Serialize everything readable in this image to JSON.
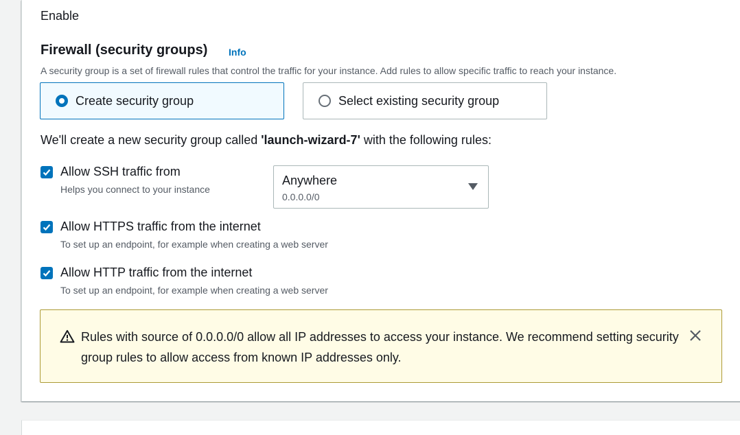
{
  "enable_text": "Enable",
  "firewall": {
    "title": "Firewall (security groups)",
    "info_link": "Info",
    "description": "A security group is a set of firewall rules that control the traffic for your instance. Add rules to allow specific traffic to reach your instance."
  },
  "options": {
    "create": {
      "label": "Create security group",
      "selected": true
    },
    "existing": {
      "label": "Select existing security group",
      "selected": false
    }
  },
  "create_note": {
    "prefix": "We'll create a new security group called ",
    "name": "'launch-wizard-7'",
    "suffix": " with the following rules:"
  },
  "rules": [
    {
      "label": "Allow SSH traffic from",
      "description": "Helps you connect to your instance",
      "checked": true
    },
    {
      "label": "Allow HTTPS traffic from the internet",
      "description": "To set up an endpoint, for example when creating a web server",
      "checked": true
    },
    {
      "label": "Allow HTTP traffic from the internet",
      "description": "To set up an endpoint, for example when creating a web server",
      "checked": true
    }
  ],
  "ssh_source": {
    "value": "Anywhere",
    "sub": "0.0.0.0/0"
  },
  "alert": {
    "text": "Rules with source of 0.0.0.0/0 allow all IP addresses to access your instance. We recommend setting security group rules to allow access from known IP addresses only.",
    "icon": "warning-icon",
    "close_icon": "close-icon"
  },
  "colors": {
    "accent": "#0073bb",
    "warning_bg": "#fffce6",
    "warning_border": "#ac9a35"
  }
}
